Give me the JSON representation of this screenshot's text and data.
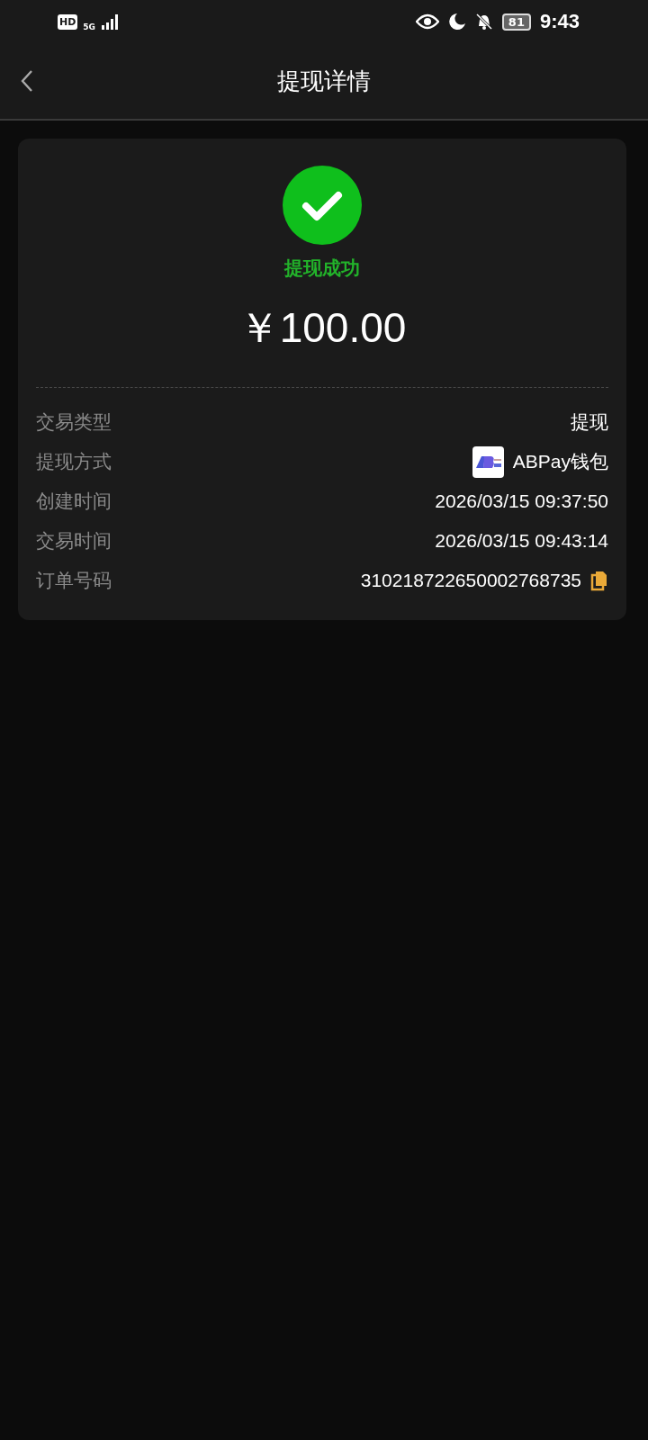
{
  "status_bar": {
    "hd": "HD",
    "network": "5G",
    "battery": "81",
    "time": "9:43"
  },
  "header": {
    "title": "提现详情"
  },
  "result": {
    "status": "提现成功",
    "amount": "￥100.00"
  },
  "details": [
    {
      "kind": "text",
      "label": "交易类型",
      "value": "提现"
    },
    {
      "kind": "method",
      "label": "提现方式",
      "value": "ABPay钱包"
    },
    {
      "kind": "text",
      "label": "创建时间",
      "value": "2026/03/15 09:37:50"
    },
    {
      "kind": "text",
      "label": "交易时间",
      "value": "2026/03/15 09:43:14"
    },
    {
      "kind": "copy",
      "label": "订单号码",
      "value": "310218722650002768735"
    }
  ]
}
